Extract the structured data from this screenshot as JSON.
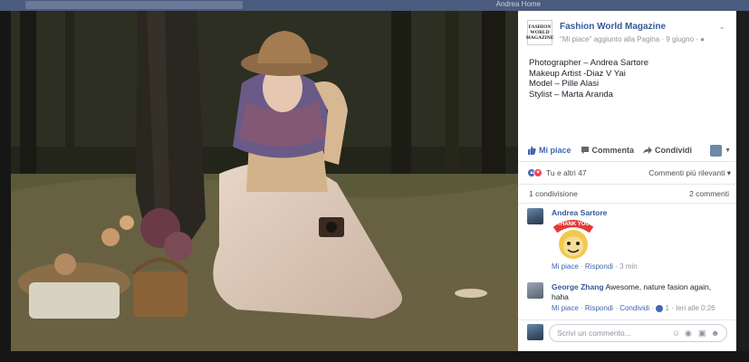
{
  "topbar": {
    "user_label": "Andrea   Home"
  },
  "post": {
    "page_name": "Fashion World Magazine",
    "logo_lines": [
      "FASHION",
      "WORLD",
      "MAGAZINE"
    ],
    "meta_action": "\"Mi piace\" aggiunto alla Pagina",
    "meta_date": "· 9 giugno ·",
    "credits": [
      "Photographer – Andrea Sartore",
      "Makeup Artist -Diaz V Yai",
      "Model – Pille Alasi",
      "Stylist – Marta Aranda"
    ]
  },
  "actions": {
    "like": "Mi piace",
    "comment": "Commenta",
    "share": "Condividi"
  },
  "reactions": {
    "summary": "Tu e altri 47",
    "order": "Commenti più rilevanti ▾"
  },
  "counts": {
    "shares": "1 condivisione",
    "comments": "2 commenti"
  },
  "comments": [
    {
      "author": "Andrea Sartore",
      "sticker_text": "THANK YOU",
      "foot_like": "Mi piace",
      "foot_reply": "Rispondi",
      "foot_time": "· 3 min"
    },
    {
      "author": "George Zhang",
      "text": "Awesome, nature fasion again, haha",
      "foot_like": "Mi piace",
      "foot_reply": "Rispondi",
      "foot_share": "Condividi",
      "foot_count": "1",
      "foot_time": "· Ieri alle 0:26"
    }
  ],
  "composer": {
    "placeholder": "Scrivi un commento..."
  },
  "colors": {
    "link": "#365899",
    "like_blue": "#4267b2",
    "love_red": "#f33e58",
    "topbar": "#4b5b7d"
  },
  "icons": [
    "thumbs-up-icon",
    "comment-icon",
    "share-icon",
    "chevron-down-icon",
    "smiley-icon",
    "camera-icon",
    "gif-icon",
    "sticker-icon"
  ]
}
